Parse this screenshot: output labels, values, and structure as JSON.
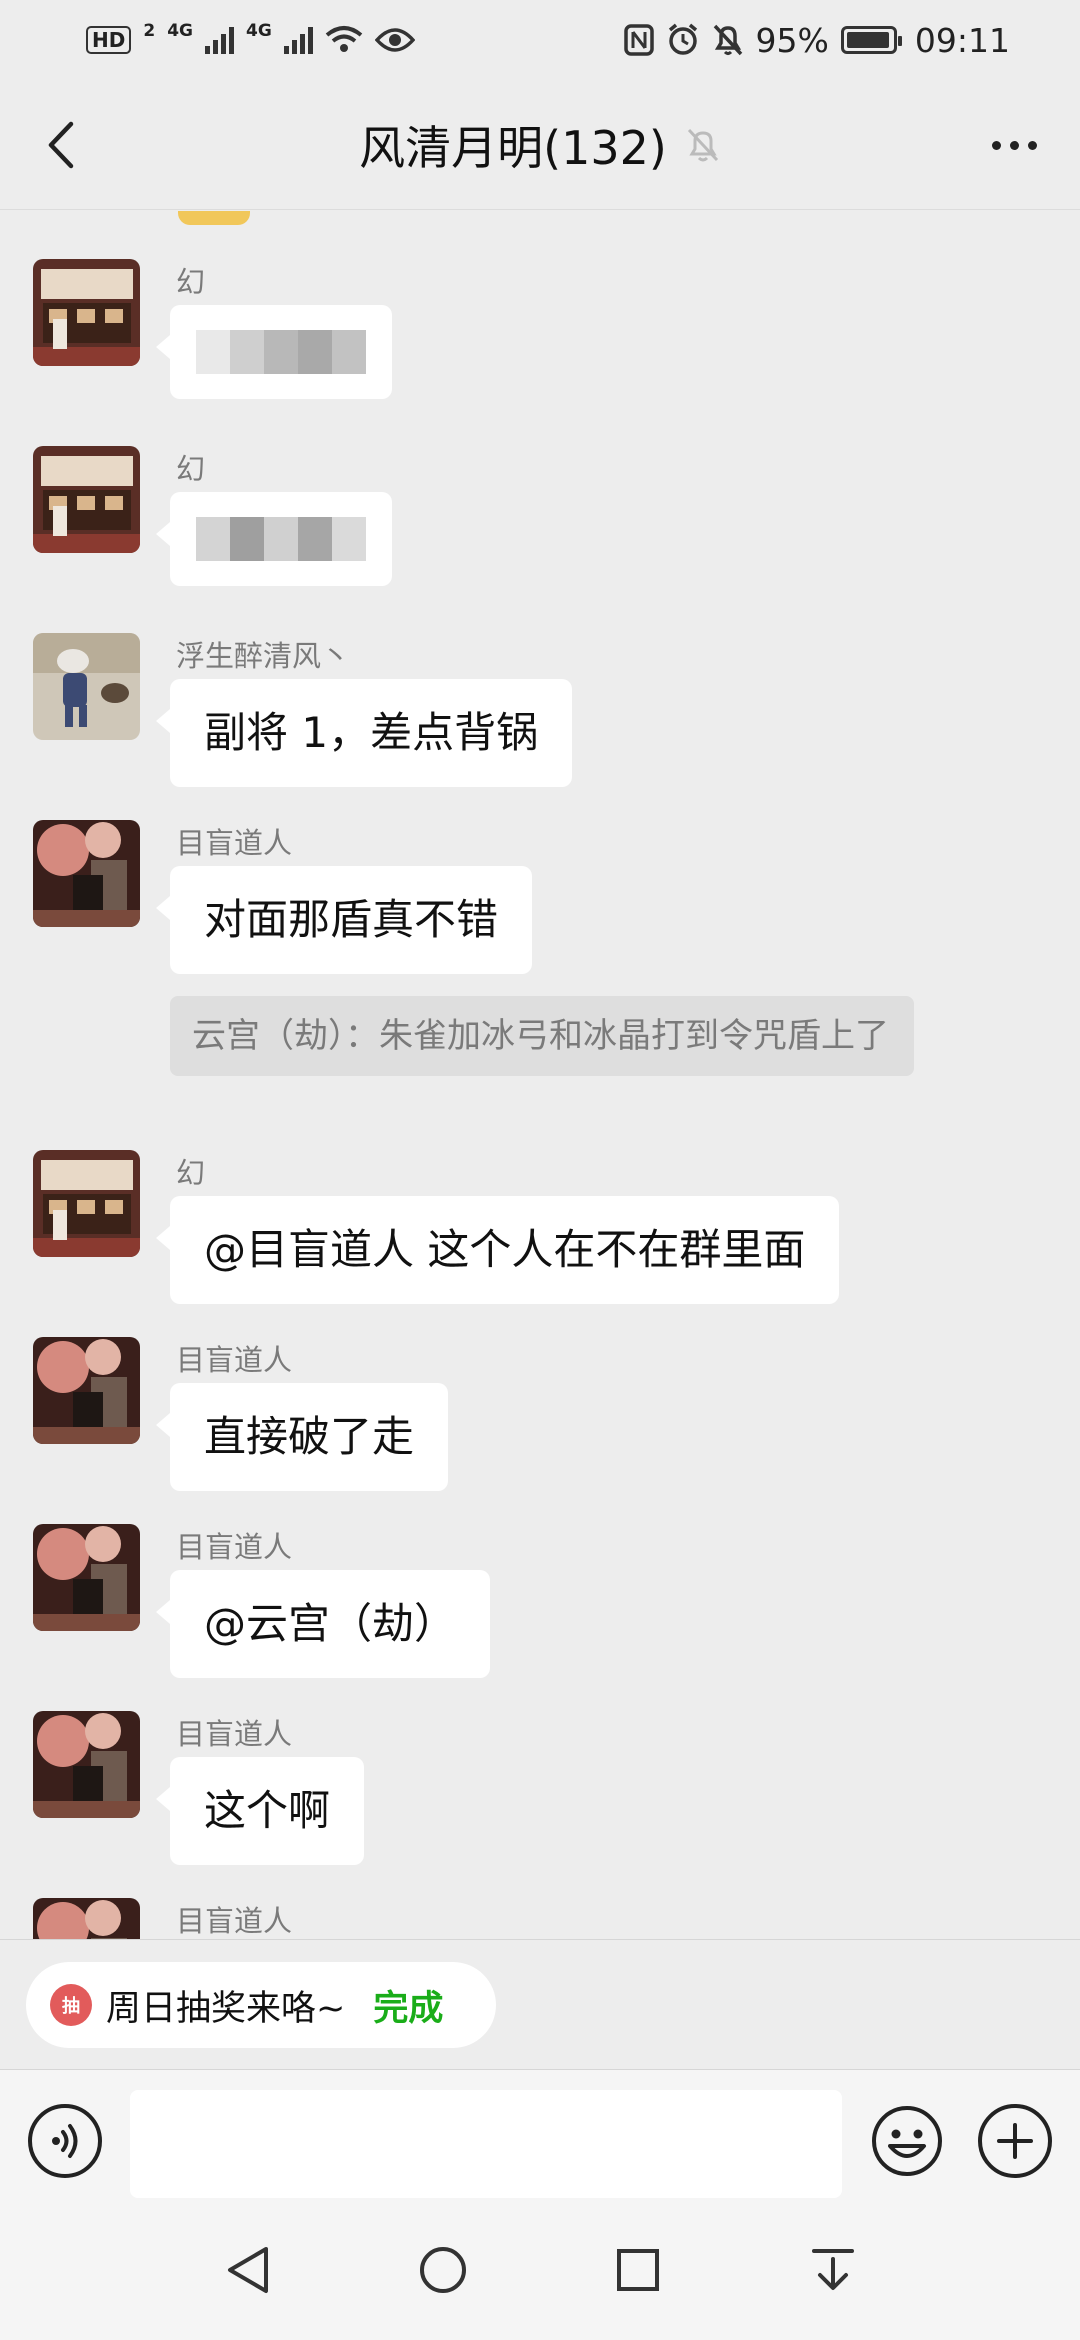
{
  "status_bar": {
    "left_badge": "HD",
    "sim_number": "2",
    "net1": "4G",
    "net2": "4G",
    "battery": "95%",
    "time": "09:11",
    "icons": [
      "hd-icon",
      "signal-icon",
      "wifi-icon",
      "eye-icon",
      "nfc-icon",
      "alarm-icon",
      "mute-icon",
      "battery-icon"
    ]
  },
  "header": {
    "title": "风清月明(132)",
    "back_icon": "chevron-left-icon",
    "muted_icon": "bell-off-icon",
    "more_icon": "more-dots-icon"
  },
  "messages": [
    {
      "sender": "幻",
      "text": "",
      "blurred": true
    },
    {
      "sender": "幻",
      "text": "",
      "blurred": true
    },
    {
      "sender": "浮生醉清风丶",
      "text": "副将 1，差点背锅"
    },
    {
      "sender": "目盲道人",
      "text": "对面那盾真不错",
      "quote": "云宫（劫）：朱雀加冰弓和冰晶打到令咒盾上了"
    },
    {
      "sender": "幻",
      "text": "@目盲道人  这个人在不在群里面"
    },
    {
      "sender": "目盲道人",
      "text": "直接破了走"
    },
    {
      "sender": "目盲道人",
      "text": "@云宫（劫）"
    },
    {
      "sender": "目盲道人",
      "text": "这个啊"
    },
    {
      "sender": "目盲道人",
      "text": ""
    }
  ],
  "task": {
    "label": "周日抽奖来咯~",
    "done": "完成",
    "icon_text": "抽"
  },
  "input_bar": {
    "placeholder": "",
    "voice_icon": "voice-icon",
    "emoji_icon": "emoji-icon",
    "plus_icon": "plus-icon"
  },
  "nav": [
    "back-triangle-icon",
    "home-circle-icon",
    "recents-square-icon",
    "notification-pull-icon"
  ],
  "colors": {
    "background": "#ededed",
    "bubble": "#ffffff",
    "accent_green": "#1aad19",
    "quote_bg": "#dedede"
  }
}
